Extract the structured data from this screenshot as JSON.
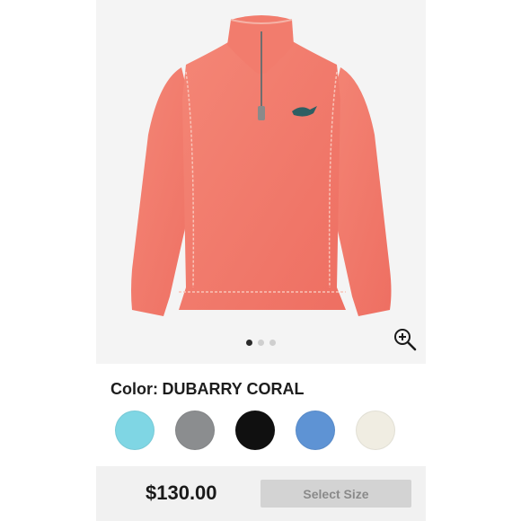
{
  "gallery": {
    "image_count": 3,
    "active_index": 0,
    "zoom_icon": "zoom-in-icon",
    "product_color": "#f07a6c"
  },
  "color": {
    "label": "Color:",
    "selected": "DUBARRY CORAL"
  },
  "swatches": [
    {
      "name": "light-aqua",
      "hex": "#7fd6e4"
    },
    {
      "name": "gray",
      "hex": "#8b8d8f"
    },
    {
      "name": "black",
      "hex": "#101010"
    },
    {
      "name": "cornflower-blue",
      "hex": "#5e93d4"
    },
    {
      "name": "off-white",
      "hex": "#f0ede2"
    }
  ],
  "footer": {
    "price": "$130.00",
    "select_size_label": "Select Size"
  }
}
